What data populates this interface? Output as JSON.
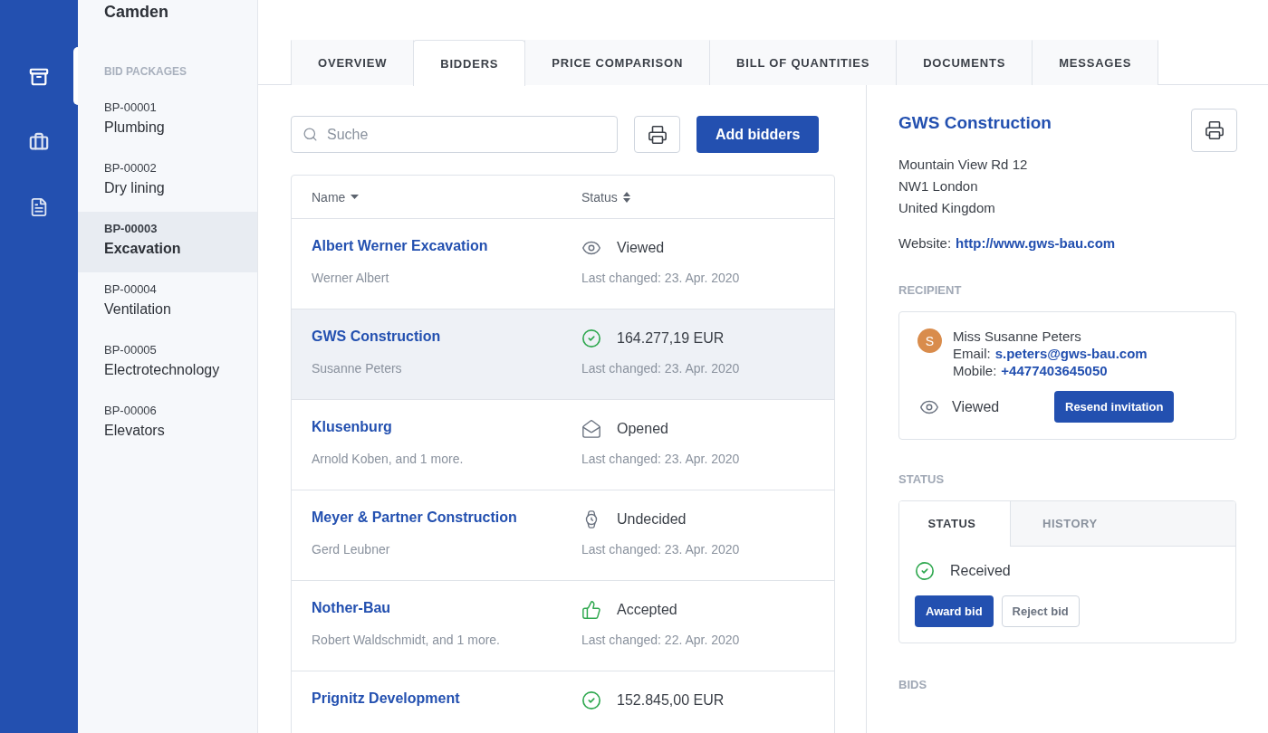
{
  "rail": {
    "items": [
      {
        "kind": "archive",
        "selected": true
      },
      {
        "kind": "briefcase",
        "selected": false
      },
      {
        "kind": "document",
        "selected": false
      }
    ]
  },
  "sidebar": {
    "title": "Camden",
    "heading": "BID PACKAGES",
    "items": [
      {
        "code": "BP-00001",
        "name": "Plumbing",
        "selected": false
      },
      {
        "code": "BP-00002",
        "name": "Dry lining",
        "selected": false
      },
      {
        "code": "BP-00003",
        "name": "Excavation",
        "selected": true
      },
      {
        "code": "BP-00004",
        "name": "Ventilation",
        "selected": false
      },
      {
        "code": "BP-00005",
        "name": "Electrotechnology",
        "selected": false
      },
      {
        "code": "BP-00006",
        "name": "Elevators",
        "selected": false
      }
    ]
  },
  "tabs": [
    {
      "label": "OVERVIEW",
      "selected": false
    },
    {
      "label": "BIDDERS",
      "selected": true
    },
    {
      "label": "PRICE COMPARISON",
      "selected": false
    },
    {
      "label": "BILL OF QUANTITIES",
      "selected": false
    },
    {
      "label": "DOCUMENTS",
      "selected": false
    },
    {
      "label": "MESSAGES",
      "selected": false
    }
  ],
  "search": {
    "placeholder": "Suche"
  },
  "add_button": "Add bidders",
  "table": {
    "columns": [
      {
        "label": "Name",
        "kind": "descending"
      },
      {
        "label": "Status",
        "kind": "sortable"
      }
    ],
    "rows": [
      {
        "name": "Albert Werner Excavation",
        "contact": "Werner Albert",
        "status": {
          "kind": "viewed",
          "text": "Viewed"
        },
        "changed": "Last changed: 23. Apr. 2020",
        "selected": false
      },
      {
        "name": "GWS Construction",
        "contact": "Susanne Peters",
        "status": {
          "kind": "received",
          "text": "164.277,19 EUR"
        },
        "changed": "Last changed: 23. Apr. 2020",
        "selected": true
      },
      {
        "name": "Klusenburg",
        "contact": "Arnold Koben, and 1 more.",
        "status": {
          "kind": "opened",
          "text": "Opened"
        },
        "changed": "Last changed: 23. Apr. 2020",
        "selected": false
      },
      {
        "name": "Meyer & Partner Construction",
        "contact": "Gerd Leubner",
        "status": {
          "kind": "undecided",
          "text": "Undecided"
        },
        "changed": "Last changed: 23. Apr. 2020",
        "selected": false
      },
      {
        "name": "Nother-Bau",
        "contact": "Robert Waldschmidt, and 1 more.",
        "status": {
          "kind": "accepted",
          "text": "Accepted"
        },
        "changed": "Last changed: 22. Apr. 2020",
        "selected": false
      },
      {
        "name": "Prignitz Development",
        "status": {
          "kind": "received",
          "text": "152.845,00 EUR"
        },
        "selected": false
      }
    ]
  },
  "detail": {
    "title": "GWS Construction",
    "address": [
      "Mountain View Rd 12",
      "NW1 London",
      "United Kingdom"
    ],
    "website_label": "Website:",
    "website": "http://www.gws-bau.com",
    "recipient_heading": "RECIPIENT",
    "recipient": {
      "initial": "S",
      "name": "Miss Susanne Peters",
      "email_label": "Email:",
      "email": "s.peters@gws-bau.com",
      "mobile_label": "Mobile:",
      "mobile": "+4477403645050",
      "status": {
        "kind": "viewed",
        "text": "Viewed"
      },
      "resend_button": "Resend invitation"
    },
    "status_heading": "STATUS",
    "status_tabs": [
      {
        "label": "STATUS",
        "selected": true
      },
      {
        "label": "HISTORY",
        "selected": false
      }
    ],
    "status": {
      "kind": "received",
      "text": "Received"
    },
    "award_button": "Award bid",
    "reject_button": "Reject bid",
    "bids_heading": "BIDS"
  }
}
